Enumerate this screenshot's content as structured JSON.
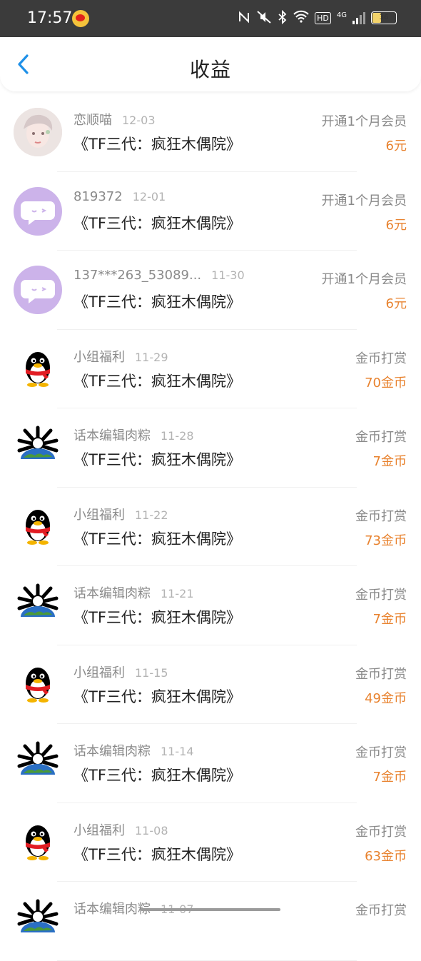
{
  "status_bar": {
    "time": "17:57",
    "icons": [
      "weibo-icon",
      "nfc-icon",
      "mute-icon",
      "bluetooth-icon",
      "wifi-icon",
      "hd-icon",
      "4g-signal-icon",
      "signal-icon",
      "battery-icon"
    ],
    "hd_label": "HD",
    "network_label": "4G",
    "battery_level": "36"
  },
  "header": {
    "title": "收益",
    "back_icon": "chevron-left-icon",
    "accent": "#1e90e8"
  },
  "colors": {
    "amount": "#e8822e",
    "secondary": "#8a8a8a"
  },
  "rows": [
    {
      "avatar": "person-photo",
      "name": "恋顺喵",
      "date": "12-03",
      "book": "《TF三代：疯狂木偶院》",
      "type": "开通1个月会员",
      "amount": "6元"
    },
    {
      "avatar": "chat-bubble",
      "name": "819372",
      "date": "12-01",
      "book": "《TF三代：疯狂木偶院》",
      "type": "开通1个月会员",
      "amount": "6元"
    },
    {
      "avatar": "chat-bubble",
      "name": "137***263_53089...",
      "date": "11-30",
      "book": "《TF三代：疯狂木偶院》",
      "type": "开通1个月会员",
      "amount": "6元"
    },
    {
      "avatar": "penguin",
      "name": "小组福利",
      "date": "11-29",
      "book": "《TF三代：疯狂木偶院》",
      "type": "金币打赏",
      "amount": "70金币"
    },
    {
      "avatar": "globe-figure",
      "name": "话本编辑肉粽",
      "date": "11-28",
      "book": "《TF三代：疯狂木偶院》",
      "type": "金币打赏",
      "amount": "7金币"
    },
    {
      "avatar": "penguin",
      "name": "小组福利",
      "date": "11-22",
      "book": "《TF三代：疯狂木偶院》",
      "type": "金币打赏",
      "amount": "73金币"
    },
    {
      "avatar": "globe-figure",
      "name": "话本编辑肉粽",
      "date": "11-21",
      "book": "《TF三代：疯狂木偶院》",
      "type": "金币打赏",
      "amount": "7金币"
    },
    {
      "avatar": "penguin",
      "name": "小组福利",
      "date": "11-15",
      "book": "《TF三代：疯狂木偶院》",
      "type": "金币打赏",
      "amount": "49金币"
    },
    {
      "avatar": "globe-figure",
      "name": "话本编辑肉粽",
      "date": "11-14",
      "book": "《TF三代：疯狂木偶院》",
      "type": "金币打赏",
      "amount": "7金币"
    },
    {
      "avatar": "penguin",
      "name": "小组福利",
      "date": "11-08",
      "book": "《TF三代：疯狂木偶院》",
      "type": "金币打赏",
      "amount": "63金币"
    },
    {
      "avatar": "globe-figure",
      "name": "话本编辑肉粽",
      "date": "11-07",
      "book": "",
      "type": "金币打赏",
      "amount": ""
    }
  ]
}
